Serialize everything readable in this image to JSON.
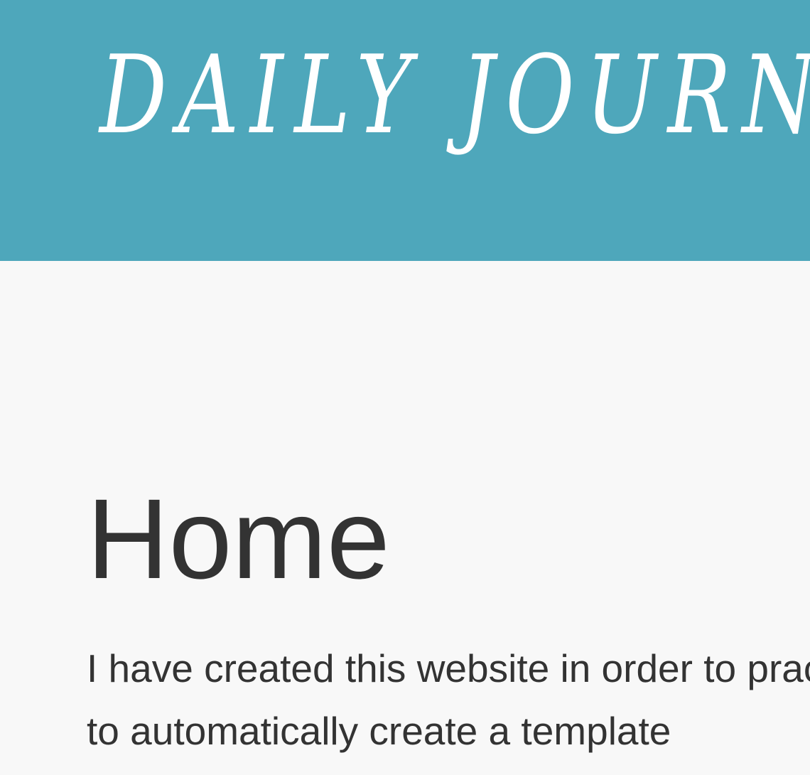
{
  "header": {
    "brand": "DAILY JOURNAL"
  },
  "main": {
    "title": "Home",
    "intro": "I have created this website in order to practice using EJS to automatically create a template"
  },
  "colors": {
    "header_bg": "#4ea7bb",
    "page_bg": "#f8f8f8",
    "text": "#333333"
  }
}
